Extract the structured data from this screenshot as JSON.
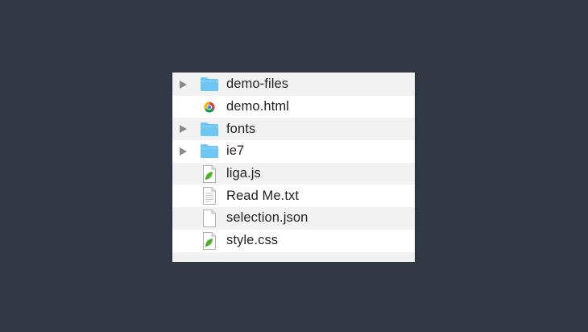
{
  "window": {
    "background": "#323944"
  },
  "files": [
    {
      "name": "demo-files",
      "kind": "folder",
      "icon": "folder-icon",
      "expandable": true
    },
    {
      "name": "demo.html",
      "kind": "html",
      "icon": "chrome-document-icon",
      "expandable": false
    },
    {
      "name": "fonts",
      "kind": "folder",
      "icon": "folder-icon",
      "expandable": true
    },
    {
      "name": "ie7",
      "kind": "folder",
      "icon": "folder-icon",
      "expandable": true
    },
    {
      "name": "liga.js",
      "kind": "js",
      "icon": "leaf-document-icon",
      "expandable": false
    },
    {
      "name": "Read Me.txt",
      "kind": "txt",
      "icon": "text-document-icon",
      "expandable": false
    },
    {
      "name": "selection.json",
      "kind": "json",
      "icon": "blank-document-icon",
      "expandable": false
    },
    {
      "name": "style.css",
      "kind": "css",
      "icon": "leaf-document-icon",
      "expandable": false
    }
  ],
  "colors": {
    "folder": "#6ec6f5",
    "row_alt": "#f2f2f2",
    "leaf": "#5cb82f"
  }
}
